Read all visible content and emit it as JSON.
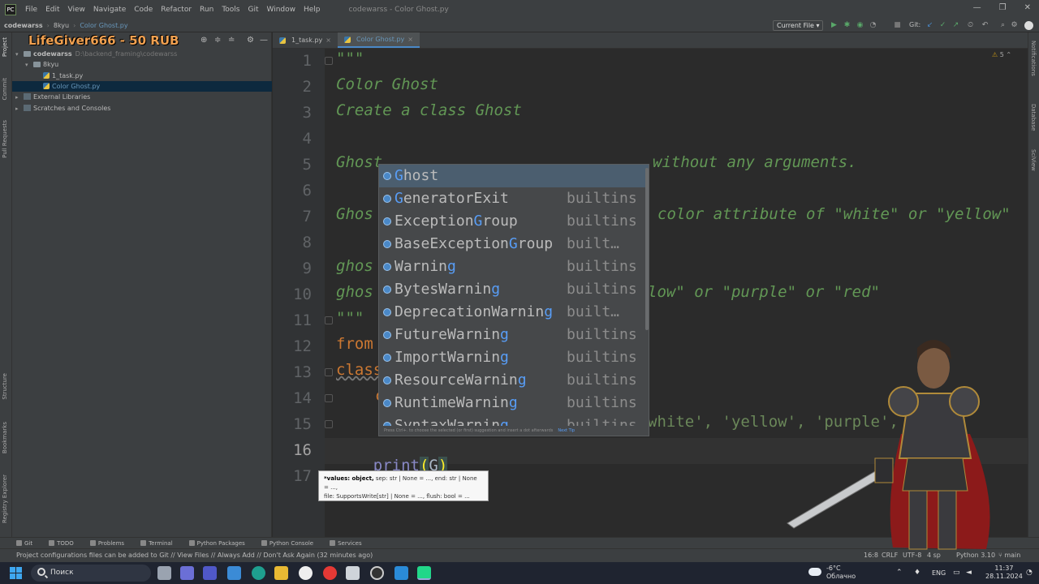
{
  "app": {
    "window_title": "codewarss - Color Ghost.py",
    "menu": [
      "File",
      "Edit",
      "View",
      "Navigate",
      "Code",
      "Refactor",
      "Run",
      "Tools",
      "Git",
      "Window",
      "Help"
    ]
  },
  "breadcrumb": [
    "codewarss",
    "8kyu",
    "Color Ghost.py"
  ],
  "toolbar": {
    "run_config": "Current File",
    "git_label": "Git:"
  },
  "overlay": {
    "banner": "LifeGiver666 - 50 RUB"
  },
  "left_strip": [
    "Project",
    "Commit",
    "Pull Requests",
    "Structure",
    "Bookmarks",
    "Registry Explorer"
  ],
  "right_strip": [
    "Notifications",
    "Database",
    "SciView"
  ],
  "project_tree": [
    {
      "label": "codewarss",
      "path": "D:\\backend_framing\\codewarss",
      "type": "folder",
      "level": 0,
      "expanded": true,
      "bold": true
    },
    {
      "label": "8kyu",
      "type": "folder",
      "level": 1,
      "expanded": true
    },
    {
      "label": "1_task.py",
      "type": "py",
      "level": 2
    },
    {
      "label": "Color Ghost.py",
      "type": "py",
      "level": 2,
      "selected": true
    },
    {
      "label": "External Libraries",
      "type": "lib",
      "level": 0,
      "expanded": false
    },
    {
      "label": "Scratches and Consoles",
      "type": "lib",
      "level": 0,
      "expanded": false
    }
  ],
  "editor_tabs": [
    {
      "label": "1_task.py",
      "active": false
    },
    {
      "label": "Color Ghost.py",
      "active": true
    }
  ],
  "inspection_count": "5",
  "line_numbers": [
    "1",
    "2",
    "3",
    "4",
    "5",
    "6",
    "7",
    "8",
    "9",
    "10",
    "11",
    "12",
    "13",
    "14",
    "15",
    "16",
    "17"
  ],
  "current_line": "16",
  "code": {
    "l1": "\"\"\"",
    "l2": "Color Ghost",
    "l3": "Create a class Ghost",
    "l5_a": "Ghost",
    "l5_b": "without any arguments.",
    "l7_a": "Ghos",
    "l7_b": "color attribute of \"white\" or \"yellow\"",
    "l9": "ghos",
    "l10_a": "ghos",
    "l10_b": "low\" or \"purple\" or \"red\"",
    "l11": "\"\"\"",
    "l12": "from",
    "l13": "class",
    "l14": "c",
    "l15": "white', 'yellow', 'purple',",
    "l16_fn": "print",
    "l16_open": "(",
    "l16_arg": "G",
    "l16_close": ")"
  },
  "completion": {
    "items": [
      {
        "match": "G",
        "rest": "host",
        "source": ""
      },
      {
        "match": "G",
        "rest": "eneratorExit",
        "source": "builtins"
      },
      {
        "pre": "Exception",
        "match": "G",
        "rest": "roup",
        "source": "builtins"
      },
      {
        "pre": "BaseException",
        "match": "G",
        "rest": "roup",
        "source": "built…"
      },
      {
        "pre": "Warnin",
        "match": "g",
        "rest": "",
        "source": "builtins"
      },
      {
        "pre": "BytesWarnin",
        "match": "g",
        "rest": "",
        "source": "builtins"
      },
      {
        "pre": "DeprecationWarnin",
        "match": "g",
        "rest": "",
        "source": "built…"
      },
      {
        "pre": "FutureWarnin",
        "match": "g",
        "rest": "",
        "source": "builtins"
      },
      {
        "pre": "ImportWarnin",
        "match": "g",
        "rest": "",
        "source": "builtins"
      },
      {
        "pre": "ResourceWarnin",
        "match": "g",
        "rest": "",
        "source": "builtins"
      },
      {
        "pre": "RuntimeWarnin",
        "match": "g",
        "rest": "",
        "source": "builtins"
      },
      {
        "pre": "SyntaxWarnin",
        "match": "g",
        "rest": "",
        "source": "builtins"
      }
    ],
    "footer": "Press Ctrl+. to choose the selected (or first) suggestion and insert a dot afterwards",
    "footer_tip": "Next Tip"
  },
  "param_info": {
    "bold": "*values: object,",
    "rest1": " sep: str | None = ..., end: str | None = ...,",
    "rest2": "file: SupportsWrite[str] | None = ..., flush: bool = ..."
  },
  "bottom_tools": [
    "Git",
    "TODO",
    "Problems",
    "Terminal",
    "Python Packages",
    "Python Console",
    "Services"
  ],
  "status": {
    "message": "Project configurations files can be added to Git // View Files // Always Add // Don't Ask Again (32 minutes ago)",
    "position": "16:8",
    "line_sep": "CRLF",
    "encoding": "UTF-8",
    "indent": "4 sp",
    "interpreter": "Python 3.10",
    "branch": "main"
  },
  "taskbar": {
    "search_placeholder": "Поиск",
    "weather_temp": "-6°C",
    "weather_desc": "Облачно",
    "lang": "ENG",
    "time": "11:37",
    "date": "28.11.2024"
  }
}
